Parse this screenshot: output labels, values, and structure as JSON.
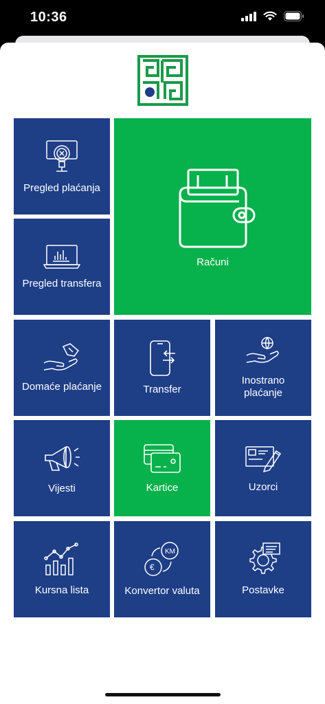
{
  "status": {
    "time": "10:36"
  },
  "tiles": [
    {
      "label": "Pregled plaćanja",
      "icon": "payment-review-icon"
    },
    {
      "label": "Računi",
      "icon": "wallet-icon"
    },
    {
      "label": "Pregled transfera",
      "icon": "transfer-review-icon"
    },
    {
      "label": "Domaće plaćanje",
      "icon": "domestic-payment-icon"
    },
    {
      "label": "Transfer",
      "icon": "phone-transfer-icon"
    },
    {
      "label": "Inostrano\nplaćanje",
      "icon": "foreign-payment-icon"
    },
    {
      "label": "Vijesti",
      "icon": "megaphone-icon"
    },
    {
      "label": "Kartice",
      "icon": "cards-icon"
    },
    {
      "label": "Uzorci",
      "icon": "sample-document-icon"
    },
    {
      "label": "Kursna lista",
      "icon": "exchange-chart-icon"
    },
    {
      "label": "Konvertor valuta",
      "icon": "currency-converter-icon"
    },
    {
      "label": "Postavke",
      "icon": "settings-gear-icon"
    }
  ],
  "colors": {
    "tile_blue": "#1e3e86",
    "tile_green": "#07b14b",
    "logo_green": "#1a9a4a",
    "logo_navy": "#1e3e86"
  }
}
